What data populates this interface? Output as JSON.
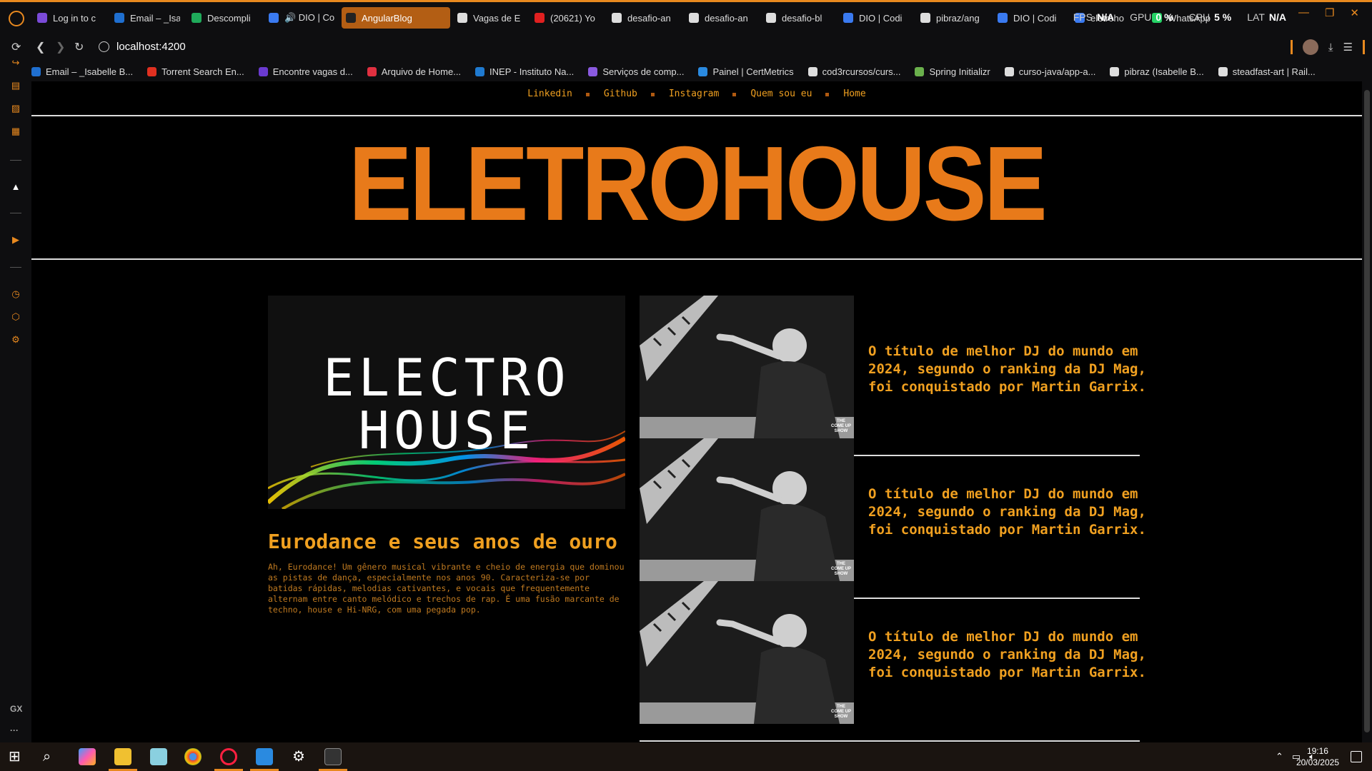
{
  "browser": {
    "tabs": [
      {
        "label": "Log in to c",
        "color": "#7b4bd8"
      },
      {
        "label": "Email – _Isa",
        "color": "#1f6fd0"
      },
      {
        "label": "Descompli",
        "color": "#1faa5a"
      },
      {
        "label": "🔊 DIO | Co",
        "color": "#3a7af0",
        "underline": true
      },
      {
        "label": "AngularBlog",
        "color": "#222",
        "selected": true
      },
      {
        "label": "Vagas de E",
        "color": "#ddd"
      },
      {
        "label": "(20621) Yo",
        "color": "#e02020"
      },
      {
        "label": "desafio-an",
        "color": "#ddd"
      },
      {
        "label": "desafio-an",
        "color": "#ddd"
      },
      {
        "label": "desafio-bl",
        "color": "#ddd"
      },
      {
        "label": "DIO | Codi",
        "color": "#3a7af0"
      },
      {
        "label": "pibraz/ang",
        "color": "#ddd"
      },
      {
        "label": "DIO | Codi",
        "color": "#3a7af0"
      },
      {
        "label": "eletroho",
        "color": "#3a7af0"
      },
      {
        "label": "WhatsApp",
        "color": "#25d366"
      }
    ],
    "perf": {
      "fps_label": "FPS",
      "fps": "N/A",
      "gpu_label": "GPU",
      "gpu": "0 %",
      "cpu_label": "CPU",
      "cpu": "5 %",
      "lat_label": "LAT",
      "lat": "N/A"
    },
    "url": "localhost:4200",
    "bookmarks": [
      {
        "label": "Email – _Isabelle B...",
        "color": "#1f6fd0"
      },
      {
        "label": "Torrent Search En...",
        "color": "#e03020"
      },
      {
        "label": "Encontre vagas d...",
        "color": "#6a3ad0"
      },
      {
        "label": "Arquivo de Home...",
        "color": "#e03040"
      },
      {
        "label": "INEP - Instituto Na...",
        "color": "#1f7ad0"
      },
      {
        "label": "Serviços de comp...",
        "color": "#8a5ae0"
      },
      {
        "label": "Painel | CertMetrics",
        "color": "#2a8ae0"
      },
      {
        "label": "cod3rcursos/curs...",
        "color": "#ddd"
      },
      {
        "label": "Spring Initializr",
        "color": "#6ab04c"
      },
      {
        "label": "curso-java/app-a...",
        "color": "#ddd"
      },
      {
        "label": "pibraz (Isabelle B...",
        "color": "#ddd"
      },
      {
        "label": "steadfast-art | Rail...",
        "color": "#ddd"
      }
    ],
    "sidebar_gx": "GX",
    "sidebar_more": "···"
  },
  "page": {
    "menu": [
      "Linkedin",
      "Github",
      "Instagram",
      "Quem sou eu",
      "Home"
    ],
    "logo": "ELETROHOUSE",
    "hero": {
      "image_text_1": "ELECTRO",
      "image_text_2": "HOUSE",
      "title": "Eurodance e seus anos de ouro",
      "description": "Ah, Eurodance! Um gênero musical vibrante e cheio de energia que dominou as pistas de dança, especialmente nos anos 90. Caracteriza-se por batidas rápidas, melodias cativantes, e vocais que frequentemente alternam entre canto melódico e trechos de rap. É uma fusão marcante de techno, house e Hi-NRG, com uma pegada pop."
    },
    "cards": [
      {
        "text": "O título de melhor DJ do mundo em 2024, segundo o ranking da DJ Mag, foi conquistado por Martin Garrix.",
        "image_badge": "THE COME UP SHOW"
      },
      {
        "text": "O título de melhor DJ do mundo em 2024, segundo o ranking da DJ Mag, foi conquistado por Martin Garrix.",
        "image_badge": "THE COME UP SHOW"
      },
      {
        "text": "O título de melhor DJ do mundo em 2024, segundo o ranking da DJ Mag, foi conquistado por Martin Garrix.",
        "image_badge": "THE COME UP SHOW"
      }
    ]
  },
  "taskbar": {
    "time": "19:16",
    "date": "20/03/2025"
  }
}
